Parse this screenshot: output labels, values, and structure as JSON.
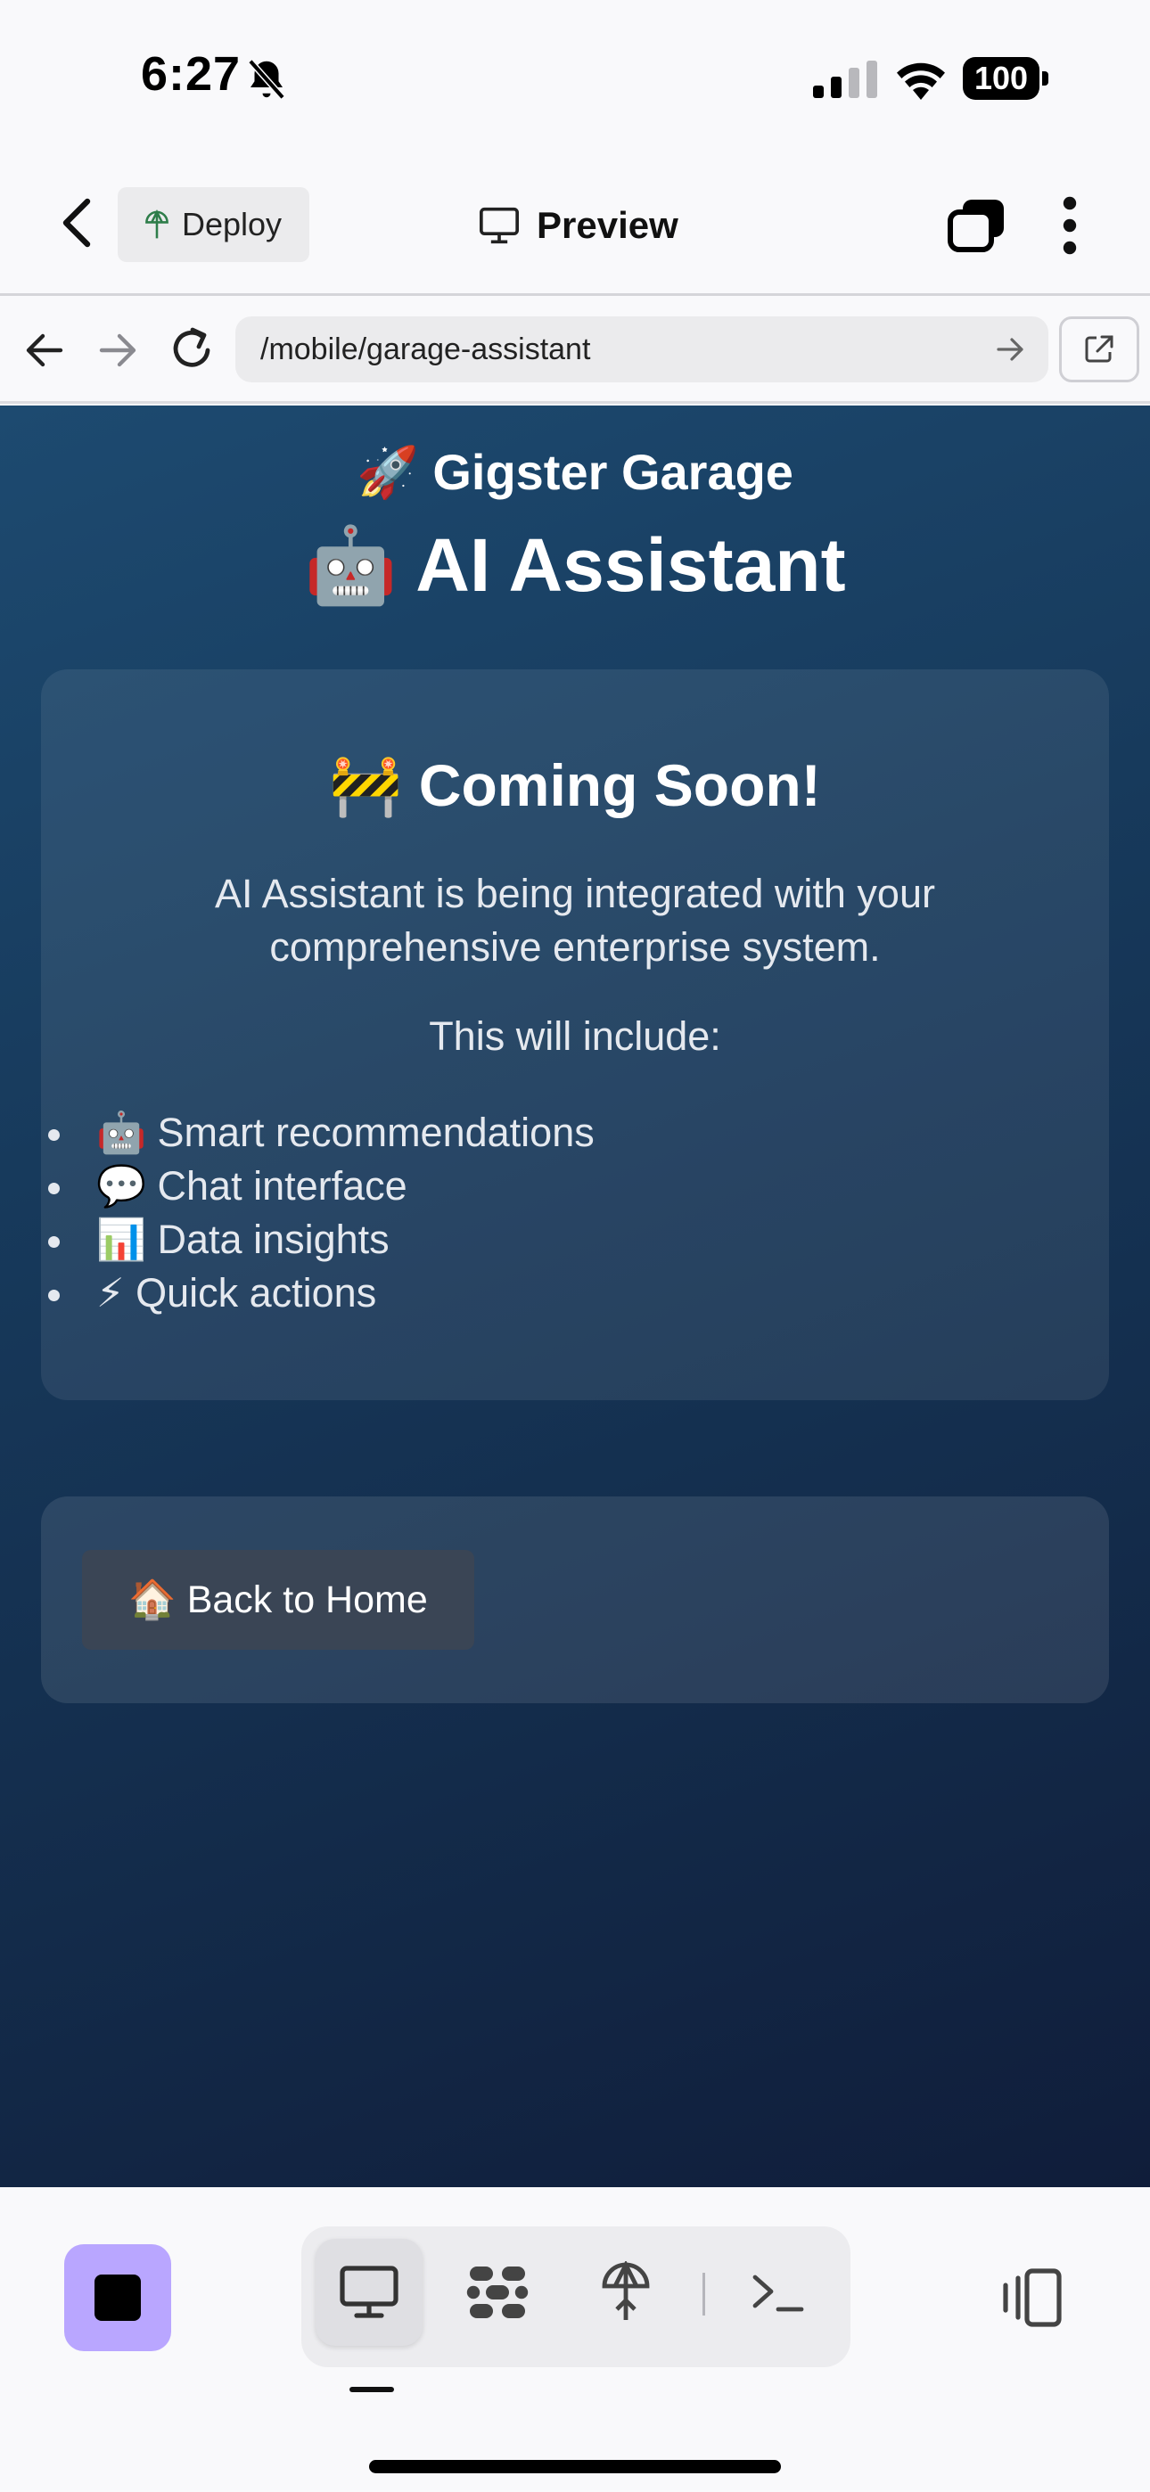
{
  "status_bar": {
    "time": "6:27",
    "battery": "100",
    "icons": [
      "bell-slash-icon",
      "cellular-signal-icon",
      "wifi-icon",
      "battery-icon"
    ]
  },
  "header": {
    "deploy_label": "Deploy",
    "title": "Preview"
  },
  "browser": {
    "url": "/mobile/garage-assistant"
  },
  "page": {
    "brand": "🚀 Gigster Garage",
    "title": "🤖 AI Assistant",
    "card": {
      "heading": "🚧 Coming Soon!",
      "description": "AI Assistant is being integrated with your comprehensive enterprise system.",
      "subheading": "This will include:",
      "features": [
        "🤖 Smart recommendations",
        "💬 Chat interface",
        "📊 Data insights",
        "⚡ Quick actions"
      ]
    },
    "back_home_label": "🏠 Back to Home"
  },
  "colors": {
    "gradient_start": "#1d4a70",
    "gradient_end": "#101d3a",
    "stop_button": "#b9a6ff",
    "home_button": "#3a4555"
  },
  "toolbar": {
    "items": [
      "preview-icon",
      "workspace-icon",
      "deploy-icon",
      "terminal-icon"
    ],
    "active": "preview-icon"
  }
}
